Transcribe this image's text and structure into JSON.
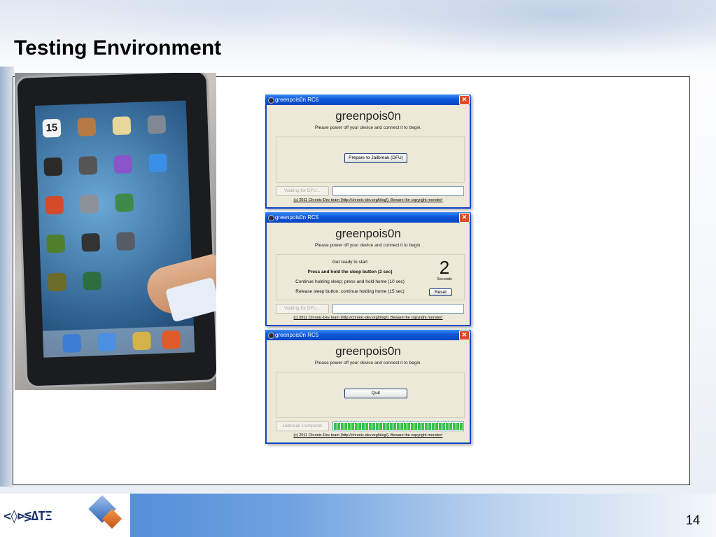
{
  "slide": {
    "title": "Testing Environment",
    "page_number": "14"
  },
  "logo": {
    "text": "<◊⊳≶ΔΤΞ"
  },
  "windows": [
    {
      "title": "greenpois0n RC6",
      "heading": "greenpois0n",
      "subtitle": "Please power off your device and connect it to begin.",
      "action_button": "Prepare to Jailbreak (DFU)",
      "status_button": "Waiting for DFU...",
      "footer": "(c) 2011 Chronic-Dev team (http://chronic-dev.org/blog/). Beware the copyright monster!"
    },
    {
      "title": "greenpois0n RC5",
      "heading": "greenpois0n",
      "subtitle": "Please power off your device and connect it to begin.",
      "steps": [
        "Get ready to start",
        "Press and hold the sleep button (2 sec)",
        "Continue holding sleep; press and hold home (10 sec)",
        "Release sleep button; continue holding home (15 sec)"
      ],
      "countdown_value": "2",
      "countdown_unit": "Seconds",
      "reset_button": "Reset",
      "status_button": "Waiting for DFU...",
      "footer": "(c) 2011 Chronic-Dev team (http://chronic-dev.org/blog/). Beware the copyright monster!"
    },
    {
      "title": "greenpois0n RC5",
      "heading": "greenpois0n",
      "subtitle": "Please power off your device and connect it to begin.",
      "quit_button": "Quit",
      "status_button": "Jailbreak Complete!",
      "progress": 1.0,
      "footer": "(c) 2011 Chronic-Dev team (http://chronic-dev.org/blog/). Beware the copyright monster!"
    }
  ],
  "photo": {
    "ipad_date_icon": "15"
  },
  "colors": {
    "titlebar": "#0b56d8",
    "window_bg": "#ece9d8",
    "progress": "#37c24a",
    "close": "#e24a2b"
  }
}
